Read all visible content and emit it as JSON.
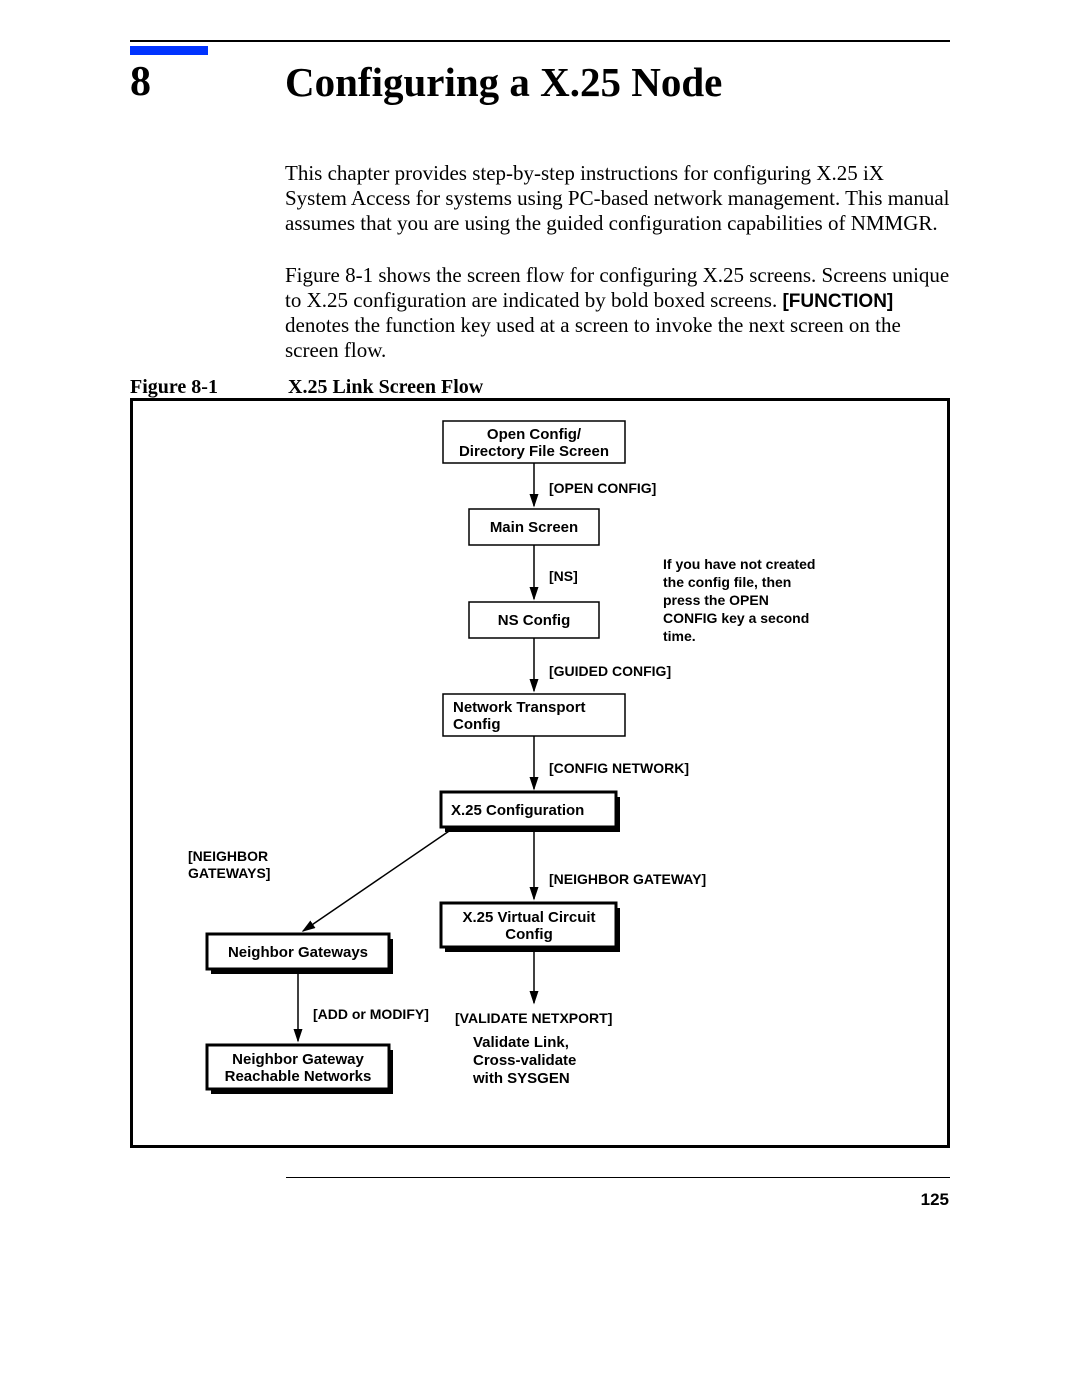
{
  "chapter": {
    "number": "8",
    "title": "Configuring a X.25 Node"
  },
  "para1": "This chapter provides step-by-step instructions for configuring X.25 iX System Access for systems using PC-based network management. This manual assumes that you are using the guided configuration capabilities of NMMGR.",
  "para2_a": "Figure 8-1 shows the screen flow for configuring X.25 screens. Screens unique to X.25 configuration are indicated by bold boxed screens. ",
  "para2_function": "[FUNCTION]",
  "para2_b": " denotes the function key used at a screen to invoke the next screen on the screen flow.",
  "figure": {
    "label": "Figure 8-1",
    "title": "X.25 Link Screen Flow"
  },
  "flow": {
    "open_config_l1": "Open Config/",
    "open_config_l2": "Directory File Screen",
    "k_open_config": "[OPEN CONFIG]",
    "main_screen": "Main Screen",
    "k_ns": "[NS]",
    "ns_config": "NS Config",
    "k_guided": "[GUIDED CONFIG]",
    "nt_config_l1": "Network Transport",
    "nt_config_l2": "Config",
    "k_config_network": "[CONFIG NETWORK]",
    "x25_config": "X.25 Configuration",
    "k_neighbor_gateways": "[NEIGHBOR",
    "k_neighbor_gateways2": "GATEWAYS]",
    "k_neighbor_gateway": "[NEIGHBOR GATEWAY]",
    "x25_vc_l1": "X.25 Virtual Circuit",
    "x25_vc_l2": "Config",
    "neighbor_gateways": "Neighbor Gateways",
    "k_add_modify": "[ADD or MODIFY]",
    "k_validate": "[VALIDATE NETXPORT]",
    "validate_l1": "Validate Link,",
    "validate_l2": "Cross-validate",
    "validate_l3": "with SYSGEN",
    "ngrn_l1": "Neighbor Gateway",
    "ngrn_l2": "Reachable Networks",
    "note_l1": "If you have not created",
    "note_l2": "the config file, then",
    "note_l3": "press the OPEN",
    "note_l4": "CONFIG key a second",
    "note_l5": "time."
  },
  "page_number": "125"
}
